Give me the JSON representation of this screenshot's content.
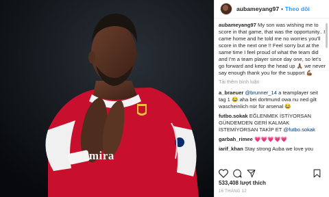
{
  "header": {
    "username": "aubameyang97",
    "separator": "•",
    "follow_label": "Theo dõi"
  },
  "caption": {
    "username": "aubameyang97",
    "text": "My son was wishing me to score in that game, that was the opportunity.. I came home and he told me no worries you'll score in the next one !! Feel sorry but at the same time I feel proud of what the team did and I'm a team player since day one, so let's go forward and keep the head up",
    "text_tail": "we never say enough thank you for the support",
    "emoji_hands": "🙏🏾",
    "emoji_muscle": "💪🏾",
    "translate_label": "Tải thêm bình luận"
  },
  "comments": [
    {
      "username": "a_braeuer",
      "mention": "@brunner_14",
      "text": " a teamplayer seit tag 1 😂 aha bei dortmund owa nu ned gilt wascheinlich nür für arsenal 😂"
    },
    {
      "username": "futbo.sokak",
      "text": " EĞLENMEK İSTİYORSAN GÜNDEMDEN GERİ KALMAK İSTEMİYORSAN TAKİP ET ",
      "mention": "@futbo.sokak"
    },
    {
      "username": "garbah_rimee",
      "text": " 💗💗💗💗💗"
    },
    {
      "username": "iarif_khan",
      "text": " Stay strong Auba we love you"
    }
  ],
  "photo": {
    "sponsor_text": "Emira"
  },
  "stats": {
    "likes": "533,408 lượt thích",
    "date": "16 THÁNG 12"
  },
  "colors": {
    "accent": "#3897f0",
    "shirt_red": "#c8102e",
    "text": "#262626",
    "muted": "#999999"
  }
}
